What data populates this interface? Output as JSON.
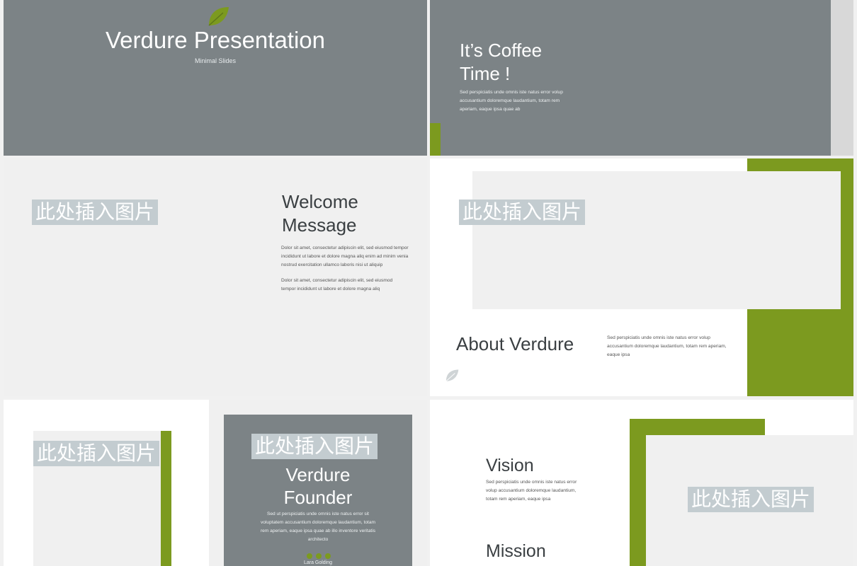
{
  "placeholder": "此处插入图片",
  "colors": {
    "gray": "#7c8386",
    "green": "#7c9a1f",
    "light": "#f0f0f0",
    "white": "#ffffff",
    "dark_text": "#3a3f42"
  },
  "slide1": {
    "title": "Verdure Presentation",
    "subtitle": "Minimal Slides",
    "icon": "leaf-icon"
  },
  "slide2": {
    "title_line1": "It’s Coffee",
    "title_line2": "Time !",
    "body": "Sed perspiciatis unde omnis iste natus error volup accusantium doloremque laudantium, totam rem aperiam, eaque ipsa quae ab"
  },
  "slide3": {
    "title_line1": "Welcome",
    "title_line2": "Message",
    "para1": "Dolor sit amet, consectetur adipiscin elit, sed eiusmod tempor incididunt ut labore et dolore magna aliq enim ad minim venia nostrud exercitation ullamco laboris nisi ut aliquip",
    "para2": "Dolor sit amet, consectetur adipiscin elit, sed eiusmod tempor incididunt ut labore et dolore magna aliq"
  },
  "slide4": {
    "title": "About Verdure",
    "body": "Sed perspiciatis unde omnis iste natus error volup accusantium doloremque laudantium, totam rem aperiam, eaque ipsa",
    "icon": "leaf-icon"
  },
  "slide5": {
    "title_line1": "Verdure",
    "title_line2": "Founder",
    "body": "Sed ut perspiciatis unde omnis iste natus error sit voluptatem accusantium doloremque laudantium, totam rem aperiam, eaque ipsa quae ab illo inventore veritatis architecto",
    "name": "Lara Golding",
    "icons": "dots-icon"
  },
  "slide6": {
    "vision_title": "Vision",
    "vision_body": "Sed perspiciatis unde omnis iste natus error volup accusantium doloremque laudantium, totam rem aperiam, eaque ipsa",
    "mission_title": "Mission"
  }
}
